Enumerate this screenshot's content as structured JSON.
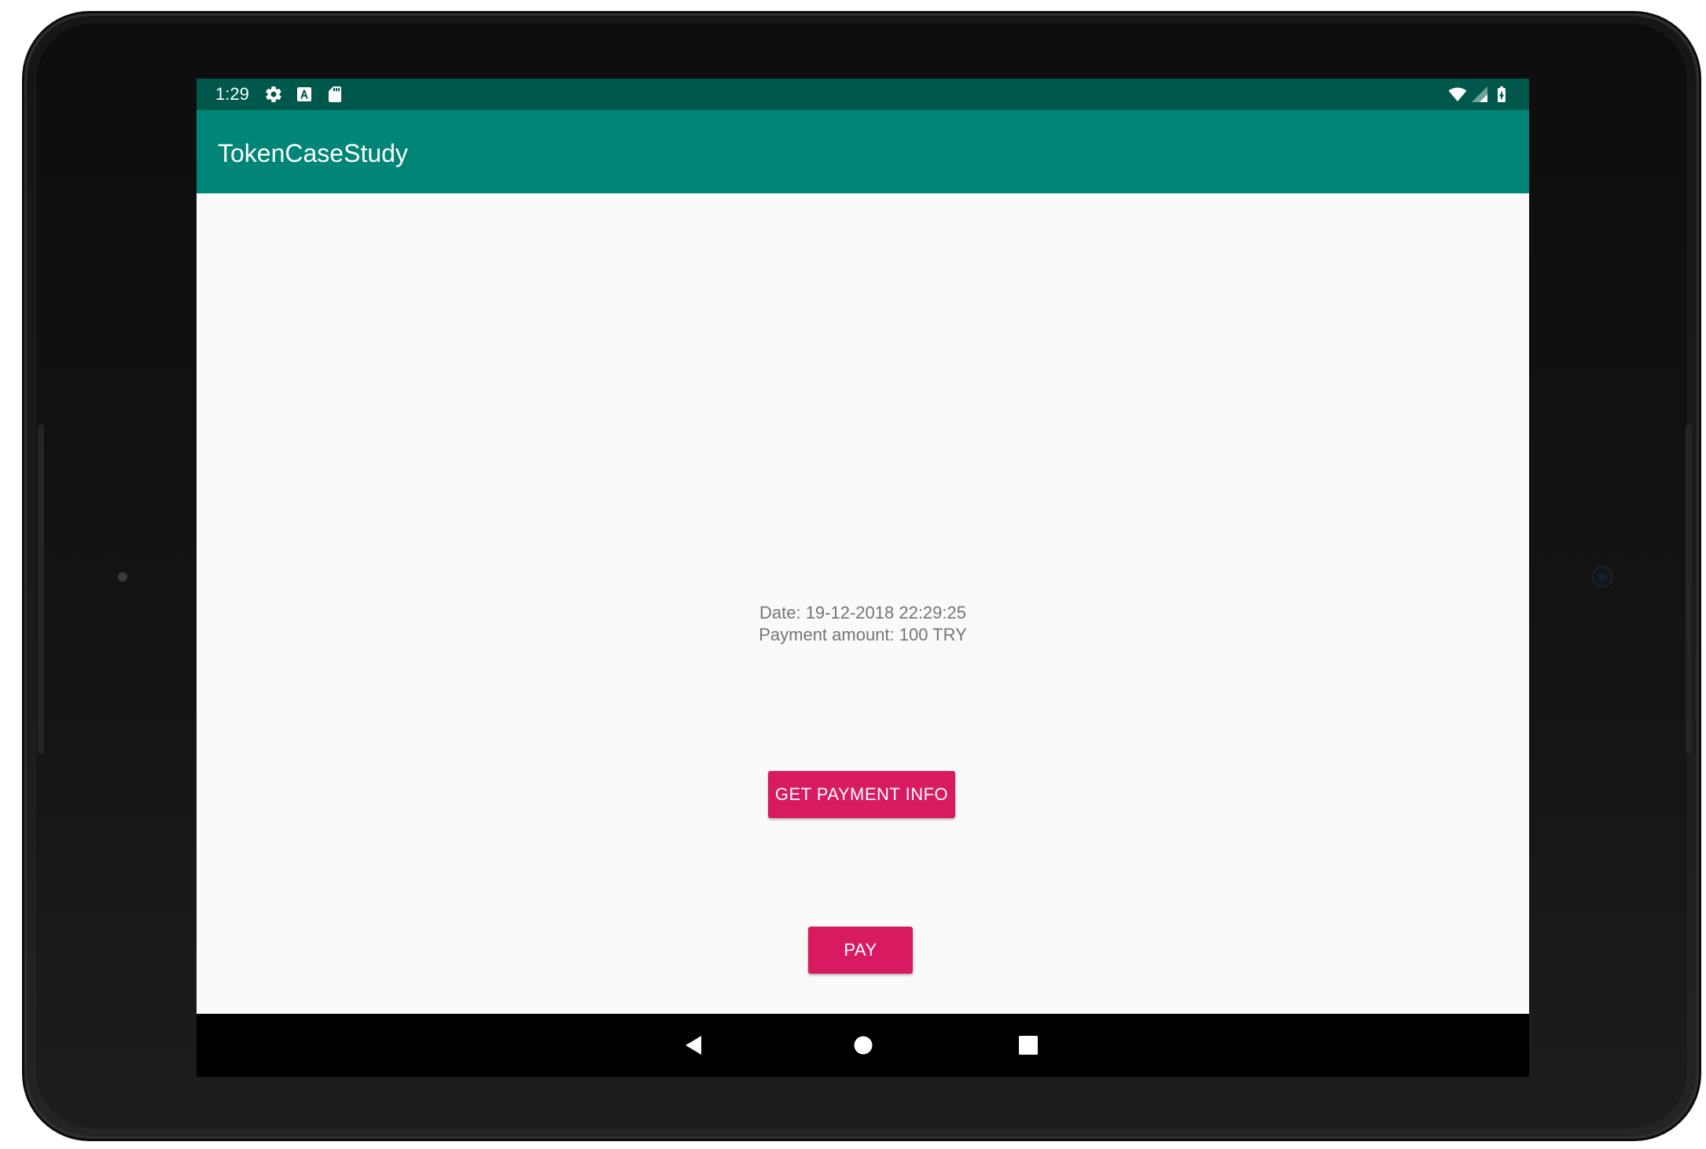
{
  "status_bar": {
    "time": "1:29",
    "left_icons": [
      "gear-icon",
      "a-notification-icon",
      "sd-card-icon"
    ],
    "right_icons": [
      "wifi-icon",
      "cell-signal-icon",
      "battery-charging-icon"
    ]
  },
  "app_bar": {
    "title": "TokenCaseStudy"
  },
  "main": {
    "date_line": "Date: 19-12-2018 22:29:25",
    "amount_line": "Payment amount: 100 TRY",
    "get_info_button": "GET PAYMENT INFO",
    "pay_button": "PAY"
  },
  "nav_bar": {
    "icons": [
      "back-icon",
      "home-icon",
      "recents-icon"
    ]
  },
  "colors": {
    "status_bar": "#00574b",
    "app_bar": "#008577",
    "accent": "#d81b60",
    "background": "#fafafa",
    "text_secondary": "#757575"
  }
}
